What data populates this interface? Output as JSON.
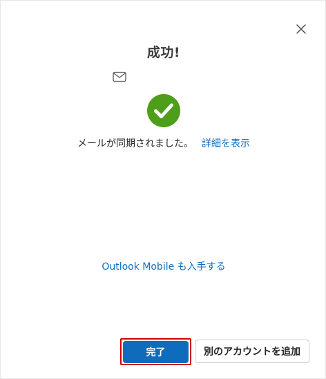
{
  "dialog": {
    "title": "成功!",
    "status_message": "メールが同期されました。",
    "details_link": "詳細を表示",
    "mobile_link": "Outlook Mobile も入手する",
    "done_button": "完了",
    "add_account_button": "別のアカウントを追加"
  },
  "icons": {
    "close": "close-icon",
    "mail": "mail-icon",
    "success": "checkmark-circle-icon"
  },
  "colors": {
    "accent": "#0f6cbd",
    "success": "#4e9e1a",
    "highlight_border": "#d10000"
  }
}
